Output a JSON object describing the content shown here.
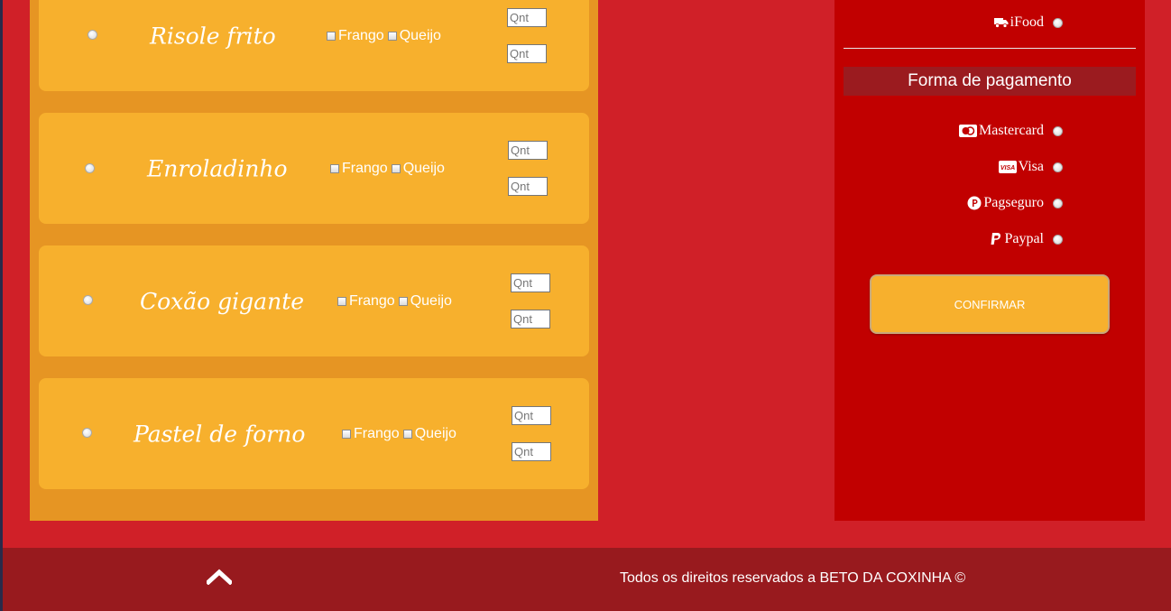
{
  "menu": {
    "items": [
      {
        "name": "Risole frito",
        "option1": "Frango",
        "option2": "Queijo",
        "qty_placeholder": "Qnt"
      },
      {
        "name": "Enroladinho",
        "option1": "Frango",
        "option2": "Queijo",
        "qty_placeholder": "Qnt"
      },
      {
        "name": "Coxão gigante",
        "option1": "Frango",
        "option2": "Queijo",
        "qty_placeholder": "Qnt"
      },
      {
        "name": "Pastel de forno",
        "option1": "Frango",
        "option2": "Queijo",
        "qty_placeholder": "Qnt"
      }
    ]
  },
  "delivery": {
    "ifood_label": "iFood",
    "ifood_icon": "truck-icon"
  },
  "payment": {
    "title": "Forma de pagamento",
    "methods": [
      {
        "label": "Mastercard",
        "icon": "mastercard-icon"
      },
      {
        "label": "Visa",
        "icon": "visa-icon"
      },
      {
        "label": "Pagseguro",
        "icon": "pagseguro-icon"
      },
      {
        "label": "Paypal",
        "icon": "paypal-icon"
      }
    ],
    "confirm_label": "CONFIRMAR"
  },
  "footer": {
    "copyright": "Todos os direitos reservados a BETO DA COXINHA ©",
    "back_to_top_icon": "chevron-up-icon"
  },
  "colors": {
    "page_bg": "#d02028",
    "menu_panel": "#e69523",
    "card": "#f7b02d",
    "side_panel": "#c10000",
    "footer": "#981a1e",
    "pay_header": "#9b1b1f"
  }
}
